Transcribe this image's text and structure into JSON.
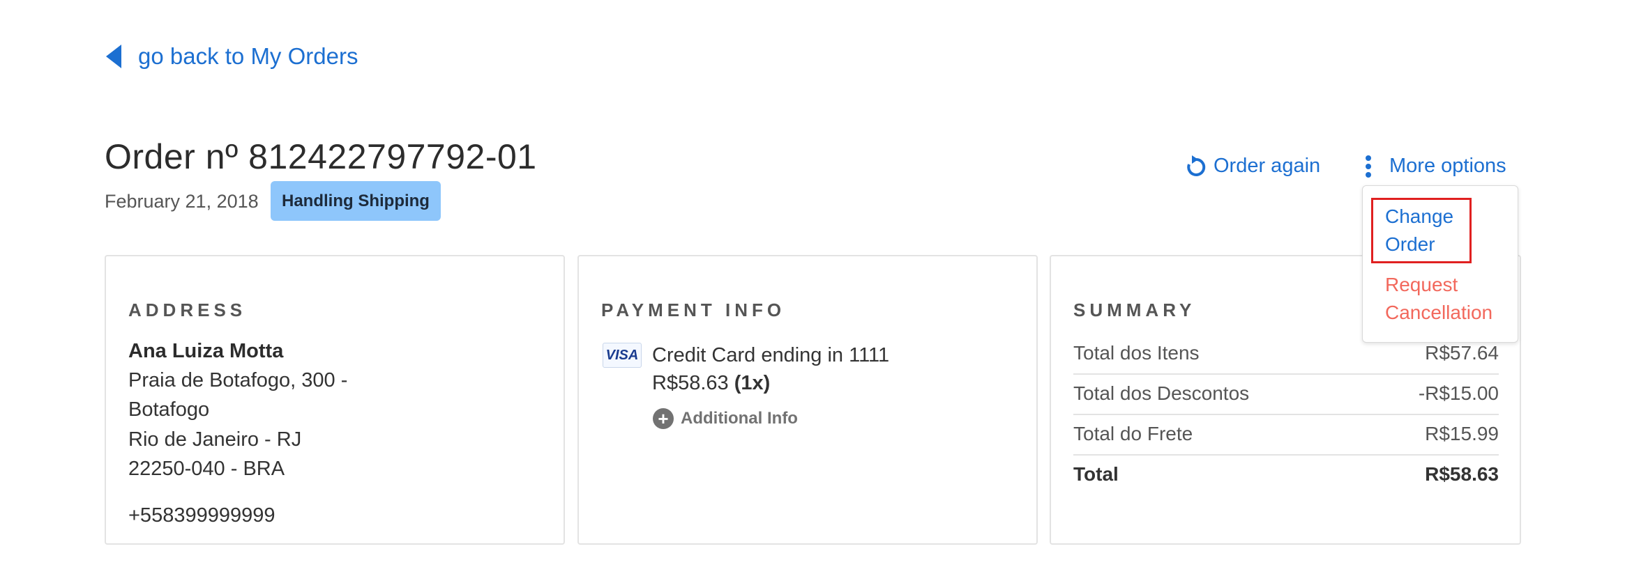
{
  "back_link": {
    "label": "go back to My Orders"
  },
  "order": {
    "title": "Order nº 812422797792-01",
    "date": "February 21, 2018",
    "status": "Handling Shipping"
  },
  "actions": {
    "order_again": "Order again",
    "more_options": "More options"
  },
  "dropdown": {
    "items": [
      {
        "line1": "Change",
        "line2": "Order",
        "color": "#1c6fd1"
      },
      {
        "line1": "Request",
        "line2": "Cancellation",
        "color": "#f2685c"
      }
    ]
  },
  "address": {
    "heading": "ADDRESS",
    "name": "Ana Luiza Motta",
    "street": "Praia de Botafogo, 300 -",
    "neighborhood": "Botafogo",
    "city": "Rio de Janeiro - RJ",
    "postal": "22250-040 - BRA",
    "phone": "+558399999999"
  },
  "payment": {
    "heading": "PAYMENT INFO",
    "card_brand": "VISA",
    "card_text": "Credit Card ending in 1111",
    "amount": "R$58.63",
    "installments": "(1x)",
    "additional_info": "Additional Info"
  },
  "summary": {
    "heading": "SUMMARY",
    "rows": [
      {
        "label": "Total dos Itens",
        "value": "R$57.64"
      },
      {
        "label": "Total dos Descontos",
        "value": "-R$15.00"
      },
      {
        "label": "Total do Frete",
        "value": "R$15.99"
      },
      {
        "label": "Total",
        "value": "R$58.63"
      }
    ]
  },
  "colors": {
    "link": "#1c6fd1",
    "danger": "#f2685c",
    "badge": "#8ec6fb",
    "highlight": "#e02020"
  }
}
